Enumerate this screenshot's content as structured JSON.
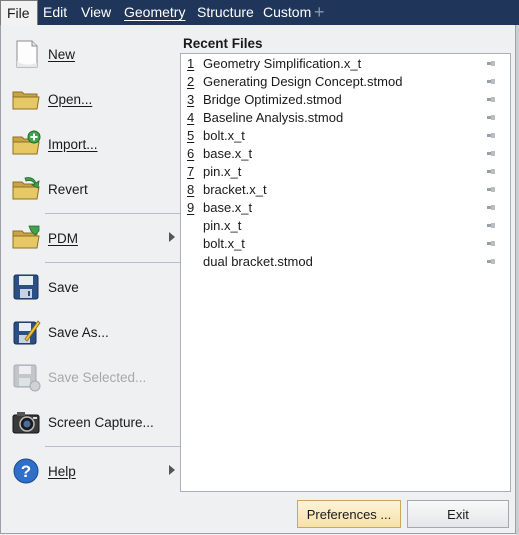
{
  "menubar": {
    "items": [
      {
        "label": "File",
        "active": true
      },
      {
        "label": "Edit"
      },
      {
        "label": "View"
      },
      {
        "label": "Geometry"
      },
      {
        "label": "Structure"
      },
      {
        "label": "Custom"
      }
    ],
    "add_tab_icon": "plus-icon"
  },
  "file_menu": {
    "items": [
      {
        "label": "New",
        "icon": "new-document-icon"
      },
      {
        "label": "Open...",
        "icon": "open-folder-icon"
      },
      {
        "label": "Import...",
        "icon": "import-folder-icon"
      },
      {
        "label": "Revert",
        "icon": "revert-folder-icon"
      },
      {
        "label": "PDM",
        "icon": "pdm-folder-icon",
        "has_submenu": true
      },
      {
        "label": "Save",
        "icon": "save-disk-icon"
      },
      {
        "label": "Save As...",
        "icon": "save-as-icon"
      },
      {
        "label": "Save Selected...",
        "icon": "save-selected-icon",
        "disabled": true
      },
      {
        "label": "Screen Capture...",
        "icon": "camera-icon"
      },
      {
        "label": "Help",
        "icon": "help-icon",
        "has_submenu": true
      }
    ]
  },
  "recent": {
    "title": "Recent Files",
    "files": [
      {
        "num": "1",
        "name": "Geometry Simplification.x_t"
      },
      {
        "num": "2",
        "name": "Generating Design Concept.stmod"
      },
      {
        "num": "3",
        "name": "Bridge Optimized.stmod"
      },
      {
        "num": "4",
        "name": "Baseline Analysis.stmod"
      },
      {
        "num": "5",
        "name": "bolt.x_t"
      },
      {
        "num": "6",
        "name": "base.x_t"
      },
      {
        "num": "7",
        "name": "pin.x_t"
      },
      {
        "num": "8",
        "name": "bracket.x_t"
      },
      {
        "num": "9",
        "name": "base.x_t"
      },
      {
        "num": "",
        "name": "pin.x_t"
      },
      {
        "num": "",
        "name": "bolt.x_t"
      },
      {
        "num": "",
        "name": "dual bracket.stmod"
      }
    ]
  },
  "buttons": {
    "preferences": "Preferences ...",
    "exit": "Exit"
  },
  "colors": {
    "menubar_bg": "#1f3559",
    "panel_bg": "#eef0f2",
    "preferences_bg": "#f6e1a8"
  }
}
